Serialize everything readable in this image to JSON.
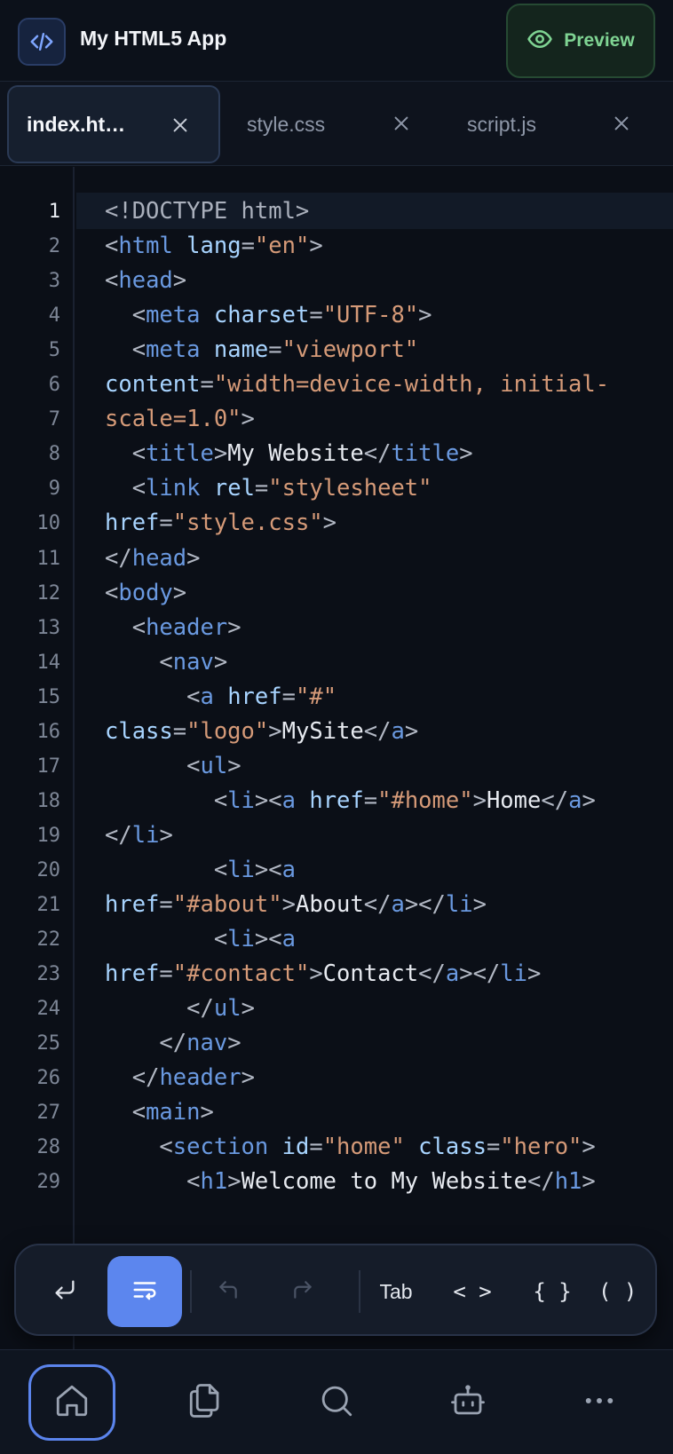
{
  "app": {
    "title": "My HTML5 App",
    "icon": "code-icon"
  },
  "header": {
    "preview_label": "Preview",
    "preview_icon": "eye-icon"
  },
  "tabs": [
    {
      "label": "index.ht…",
      "active": true
    },
    {
      "label": "style.css",
      "active": false
    },
    {
      "label": "script.js",
      "active": false
    }
  ],
  "editor": {
    "active_line": 1,
    "line_numbers": [
      "1",
      "2",
      "3",
      "4",
      "5",
      "6",
      "7",
      "8",
      "9",
      "10",
      "11",
      "12",
      "13",
      "14",
      "15",
      "16",
      "17",
      "18",
      "19",
      "20",
      "21",
      "22",
      "23",
      "24",
      "25",
      "26",
      "27",
      "28",
      "29"
    ],
    "lines": [
      [
        [
          "dt",
          "<!DOCTYPE html>"
        ]
      ],
      [
        [
          "br",
          "<"
        ],
        [
          "tag",
          "html"
        ],
        [
          "tx",
          " "
        ],
        [
          "at",
          "lang"
        ],
        [
          "br",
          "="
        ],
        [
          "st",
          "\"en\""
        ],
        [
          "br",
          ">"
        ]
      ],
      [
        [
          "br",
          "<"
        ],
        [
          "tag",
          "head"
        ],
        [
          "br",
          ">"
        ]
      ],
      [
        [
          "tx",
          "  "
        ],
        [
          "br",
          "<"
        ],
        [
          "tag",
          "meta"
        ],
        [
          "tx",
          " "
        ],
        [
          "at",
          "charset"
        ],
        [
          "br",
          "="
        ],
        [
          "st",
          "\"UTF-8\""
        ],
        [
          "br",
          ">"
        ]
      ],
      [
        [
          "tx",
          "  "
        ],
        [
          "br",
          "<"
        ],
        [
          "tag",
          "meta"
        ],
        [
          "tx",
          " "
        ],
        [
          "at",
          "name"
        ],
        [
          "br",
          "="
        ],
        [
          "st",
          "\"viewport\""
        ]
      ],
      [
        [
          "at",
          "content"
        ],
        [
          "br",
          "="
        ],
        [
          "st",
          "\"width=device-width, initial-"
        ]
      ],
      [
        [
          "st",
          "scale=1.0\""
        ],
        [
          "br",
          ">"
        ]
      ],
      [
        [
          "tx",
          "  "
        ],
        [
          "br",
          "<"
        ],
        [
          "tag",
          "title"
        ],
        [
          "br",
          ">"
        ],
        [
          "tx",
          "My Website"
        ],
        [
          "br",
          "</"
        ],
        [
          "tag",
          "title"
        ],
        [
          "br",
          ">"
        ]
      ],
      [
        [
          "tx",
          "  "
        ],
        [
          "br",
          "<"
        ],
        [
          "tag",
          "link"
        ],
        [
          "tx",
          " "
        ],
        [
          "at",
          "rel"
        ],
        [
          "br",
          "="
        ],
        [
          "st",
          "\"stylesheet\""
        ]
      ],
      [
        [
          "at",
          "href"
        ],
        [
          "br",
          "="
        ],
        [
          "st",
          "\"style.css\""
        ],
        [
          "br",
          ">"
        ]
      ],
      [
        [
          "br",
          "</"
        ],
        [
          "tag",
          "head"
        ],
        [
          "br",
          ">"
        ]
      ],
      [
        [
          "br",
          "<"
        ],
        [
          "tag",
          "body"
        ],
        [
          "br",
          ">"
        ]
      ],
      [
        [
          "tx",
          "  "
        ],
        [
          "br",
          "<"
        ],
        [
          "tag",
          "header"
        ],
        [
          "br",
          ">"
        ]
      ],
      [
        [
          "tx",
          "    "
        ],
        [
          "br",
          "<"
        ],
        [
          "tag",
          "nav"
        ],
        [
          "br",
          ">"
        ]
      ],
      [
        [
          "tx",
          "      "
        ],
        [
          "br",
          "<"
        ],
        [
          "tag",
          "a"
        ],
        [
          "tx",
          " "
        ],
        [
          "at",
          "href"
        ],
        [
          "br",
          "="
        ],
        [
          "st",
          "\"#\""
        ]
      ],
      [
        [
          "at",
          "class"
        ],
        [
          "br",
          "="
        ],
        [
          "st",
          "\"logo\""
        ],
        [
          "br",
          ">"
        ],
        [
          "tx",
          "MySite"
        ],
        [
          "br",
          "</"
        ],
        [
          "tag",
          "a"
        ],
        [
          "br",
          ">"
        ]
      ],
      [
        [
          "tx",
          "      "
        ],
        [
          "br",
          "<"
        ],
        [
          "tag",
          "ul"
        ],
        [
          "br",
          ">"
        ]
      ],
      [
        [
          "tx",
          "        "
        ],
        [
          "br",
          "<"
        ],
        [
          "tag",
          "li"
        ],
        [
          "br",
          "><"
        ],
        [
          "tag",
          "a"
        ],
        [
          "tx",
          " "
        ],
        [
          "at",
          "href"
        ],
        [
          "br",
          "="
        ],
        [
          "st",
          "\"#home\""
        ],
        [
          "br",
          ">"
        ],
        [
          "tx",
          "Home"
        ],
        [
          "br",
          "</"
        ],
        [
          "tag",
          "a"
        ],
        [
          "br",
          ">"
        ]
      ],
      [
        [
          "br",
          "</"
        ],
        [
          "tag",
          "li"
        ],
        [
          "br",
          ">"
        ]
      ],
      [
        [
          "tx",
          "        "
        ],
        [
          "br",
          "<"
        ],
        [
          "tag",
          "li"
        ],
        [
          "br",
          "><"
        ],
        [
          "tag",
          "a"
        ]
      ],
      [
        [
          "at",
          "href"
        ],
        [
          "br",
          "="
        ],
        [
          "st",
          "\"#about\""
        ],
        [
          "br",
          ">"
        ],
        [
          "tx",
          "About"
        ],
        [
          "br",
          "</"
        ],
        [
          "tag",
          "a"
        ],
        [
          "br",
          "></"
        ],
        [
          "tag",
          "li"
        ],
        [
          "br",
          ">"
        ]
      ],
      [
        [
          "tx",
          "        "
        ],
        [
          "br",
          "<"
        ],
        [
          "tag",
          "li"
        ],
        [
          "br",
          "><"
        ],
        [
          "tag",
          "a"
        ]
      ],
      [
        [
          "at",
          "href"
        ],
        [
          "br",
          "="
        ],
        [
          "st",
          "\"#contact\""
        ],
        [
          "br",
          ">"
        ],
        [
          "tx",
          "Contact"
        ],
        [
          "br",
          "</"
        ],
        [
          "tag",
          "a"
        ],
        [
          "br",
          "></"
        ],
        [
          "tag",
          "li"
        ],
        [
          "br",
          ">"
        ]
      ],
      [
        [
          "tx",
          "      "
        ],
        [
          "br",
          "</"
        ],
        [
          "tag",
          "ul"
        ],
        [
          "br",
          ">"
        ]
      ],
      [
        [
          "tx",
          "    "
        ],
        [
          "br",
          "</"
        ],
        [
          "tag",
          "nav"
        ],
        [
          "br",
          ">"
        ]
      ],
      [
        [
          "tx",
          "  "
        ],
        [
          "br",
          "</"
        ],
        [
          "tag",
          "header"
        ],
        [
          "br",
          ">"
        ]
      ],
      [
        [
          "tx",
          "  "
        ],
        [
          "br",
          "<"
        ],
        [
          "tag",
          "main"
        ],
        [
          "br",
          ">"
        ]
      ],
      [
        [
          "tx",
          "    "
        ],
        [
          "br",
          "<"
        ],
        [
          "tag",
          "section"
        ],
        [
          "tx",
          " "
        ],
        [
          "at",
          "id"
        ],
        [
          "br",
          "="
        ],
        [
          "st",
          "\"home\""
        ],
        [
          "tx",
          " "
        ],
        [
          "at",
          "class"
        ],
        [
          "br",
          "="
        ],
        [
          "st",
          "\"hero\""
        ],
        [
          "br",
          ">"
        ]
      ],
      [
        [
          "tx",
          "      "
        ],
        [
          "br",
          "<"
        ],
        [
          "tag",
          "h1"
        ],
        [
          "br",
          ">"
        ],
        [
          "tx",
          "Welcome to My Website"
        ],
        [
          "br",
          "</"
        ],
        [
          "tag",
          "h1"
        ],
        [
          "br",
          ">"
        ]
      ]
    ]
  },
  "keybar": {
    "enter_icon": "return-arrow-icon",
    "wrap_icon": "word-wrap-icon",
    "undo_icon": "undo-icon",
    "redo_icon": "redo-icon",
    "tab_label": "Tab",
    "angle_label": "< >",
    "brace_label": "{ }",
    "paren_label": "( )"
  },
  "bottom_nav": [
    {
      "icon": "home-icon",
      "active": true
    },
    {
      "icon": "files-icon",
      "active": false
    },
    {
      "icon": "search-icon",
      "active": false
    },
    {
      "icon": "bot-icon",
      "active": false
    },
    {
      "icon": "more-icon",
      "active": false
    }
  ],
  "colors": {
    "accent": "#5b84ec",
    "preview_green": "#7fd493",
    "tag": "#6a99e0",
    "attribute": "#a8d4ff",
    "string": "#d59a78"
  }
}
